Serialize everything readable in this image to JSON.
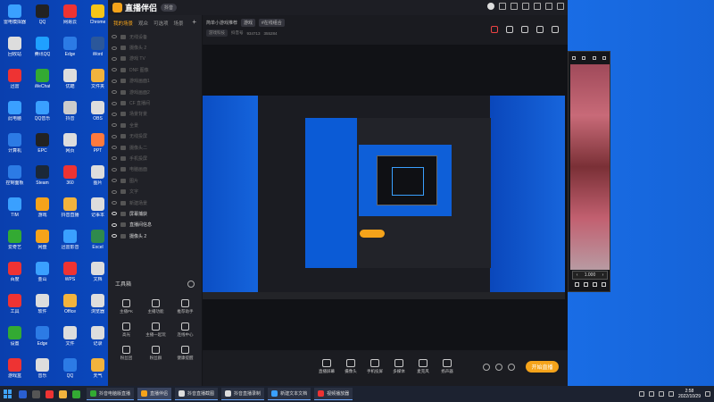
{
  "app": {
    "name": "直播伴侣",
    "version": "抖音",
    "tabs": [
      "我的场景",
      "观众",
      "可选项",
      "场景"
    ],
    "active_tab": 0,
    "scenes": [
      {
        "label": "无线设备",
        "on": false
      },
      {
        "label": "摄像头 2",
        "on": false
      },
      {
        "label": "游戏 TV",
        "on": false
      },
      {
        "label": "DNF 图像",
        "on": false
      },
      {
        "label": "游戏画面1",
        "on": false
      },
      {
        "label": "游戏画面2",
        "on": false
      },
      {
        "label": "CF 直播间",
        "on": false
      },
      {
        "label": "场景背景",
        "on": false
      },
      {
        "label": "全景",
        "on": false
      },
      {
        "label": "无线投屏",
        "on": false
      },
      {
        "label": "摄像头二",
        "on": false
      },
      {
        "label": "手机投屏",
        "on": false
      },
      {
        "label": "电脑画面",
        "on": false
      },
      {
        "label": "图片",
        "on": false
      },
      {
        "label": "文字",
        "on": false
      },
      {
        "label": "新建场景",
        "on": false
      },
      {
        "label": "屏幕捕获",
        "on": true
      },
      {
        "label": "直播间信息",
        "on": true
      },
      {
        "label": "摄像头 2",
        "on": true
      }
    ],
    "tools_label": "工具箱",
    "tools": [
      "主播PK",
      "主播功能",
      "推荐助手",
      "高光",
      "主播一起玩",
      "连线中心",
      "粉丝团",
      "粉丝群",
      "健康提醒"
    ],
    "room_title": "简单小游戏推荐",
    "room_tag": "游戏",
    "room_topic": "#在线组合",
    "room_meta": [
      "游戏科技",
      "抖音号",
      "934713",
      "355284"
    ],
    "bottom_tools": [
      "直播屏幕",
      "摄像头",
      "手机投屏",
      "多媒体",
      "麦克风",
      "扬声器"
    ],
    "live_button": "开始直播",
    "zoom_value": "1.000"
  },
  "desktop": {
    "icons": [
      {
        "label": "雷电模拟器",
        "color": "#3aa0ff"
      },
      {
        "label": "QQ",
        "color": "#222"
      },
      {
        "label": "网易云",
        "color": "#e33"
      },
      {
        "label": "Chrome",
        "color": "#f5c518"
      },
      {
        "label": "回收站",
        "color": "#ddd"
      },
      {
        "label": "腾讯QQ",
        "color": "#1fa0ff"
      },
      {
        "label": "Edge",
        "color": "#2c7be5"
      },
      {
        "label": "Word",
        "color": "#2b579a"
      },
      {
        "label": "迅雷",
        "color": "#e33"
      },
      {
        "label": "WeChat",
        "color": "#3a3"
      },
      {
        "label": "优酷",
        "color": "#ddd"
      },
      {
        "label": "文件夹",
        "color": "#f2b33d"
      },
      {
        "label": "此电脑",
        "color": "#3aa0ff"
      },
      {
        "label": "QQ音乐",
        "color": "#3aa0ff"
      },
      {
        "label": "抖音",
        "color": "#ccc"
      },
      {
        "label": "OBS",
        "color": "#ddd"
      },
      {
        "label": "计算机",
        "color": "#2c7be5"
      },
      {
        "label": "EPC",
        "color": "#222"
      },
      {
        "label": "网页",
        "color": "#ddd"
      },
      {
        "label": "PPT",
        "color": "#ff7a3d"
      },
      {
        "label": "控制面板",
        "color": "#2c7be5"
      },
      {
        "label": "Steam",
        "color": "#1b2838"
      },
      {
        "label": "360",
        "color": "#e33"
      },
      {
        "label": "图片",
        "color": "#ddd"
      },
      {
        "label": "TIM",
        "color": "#3aa0ff"
      },
      {
        "label": "游戏",
        "color": "#f5a31a"
      },
      {
        "label": "抖音直播",
        "color": "#f2b33d"
      },
      {
        "label": "记事本",
        "color": "#ddd"
      },
      {
        "label": "爱奇艺",
        "color": "#3a3"
      },
      {
        "label": "网盘",
        "color": "#f5a31a"
      },
      {
        "label": "迅雷影音",
        "color": "#3aa0ff"
      },
      {
        "label": "Excel",
        "color": "#2f8a4d"
      },
      {
        "label": "百度",
        "color": "#e33"
      },
      {
        "label": "金山",
        "color": "#3aa0ff"
      },
      {
        "label": "WPS",
        "color": "#e33"
      },
      {
        "label": "文档",
        "color": "#ddd"
      },
      {
        "label": "工具",
        "color": "#e33"
      },
      {
        "label": "软件",
        "color": "#ddd"
      },
      {
        "label": "Office",
        "color": "#f2b33d"
      },
      {
        "label": "浏览器",
        "color": "#ddd"
      },
      {
        "label": "设置",
        "color": "#3a3"
      },
      {
        "label": "Edge",
        "color": "#2c7be5"
      },
      {
        "label": "文件",
        "color": "#ddd"
      },
      {
        "label": "记录",
        "color": "#ddd"
      },
      {
        "label": "游戏盒",
        "color": "#e33"
      },
      {
        "label": "音乐",
        "color": "#ddd"
      },
      {
        "label": "QQ",
        "color": "#2c7be5"
      },
      {
        "label": "天气",
        "color": "#f2b33d"
      }
    ]
  },
  "taskbar": {
    "tasks": [
      {
        "label": "抖音电脑版直播",
        "color": "#3a3",
        "active": false
      },
      {
        "label": "直播伴侣",
        "color": "#f5a31a",
        "active": true
      },
      {
        "label": "抖音直播截图",
        "color": "#ddd",
        "active": false
      },
      {
        "label": "抖音直播录制",
        "color": "#ddd",
        "active": false
      },
      {
        "label": "新建文本文档",
        "color": "#3aa0ff",
        "active": false
      },
      {
        "label": "视频播放器",
        "color": "#e33",
        "active": false
      }
    ],
    "time": "2:58",
    "date": "2022/10/29"
  }
}
